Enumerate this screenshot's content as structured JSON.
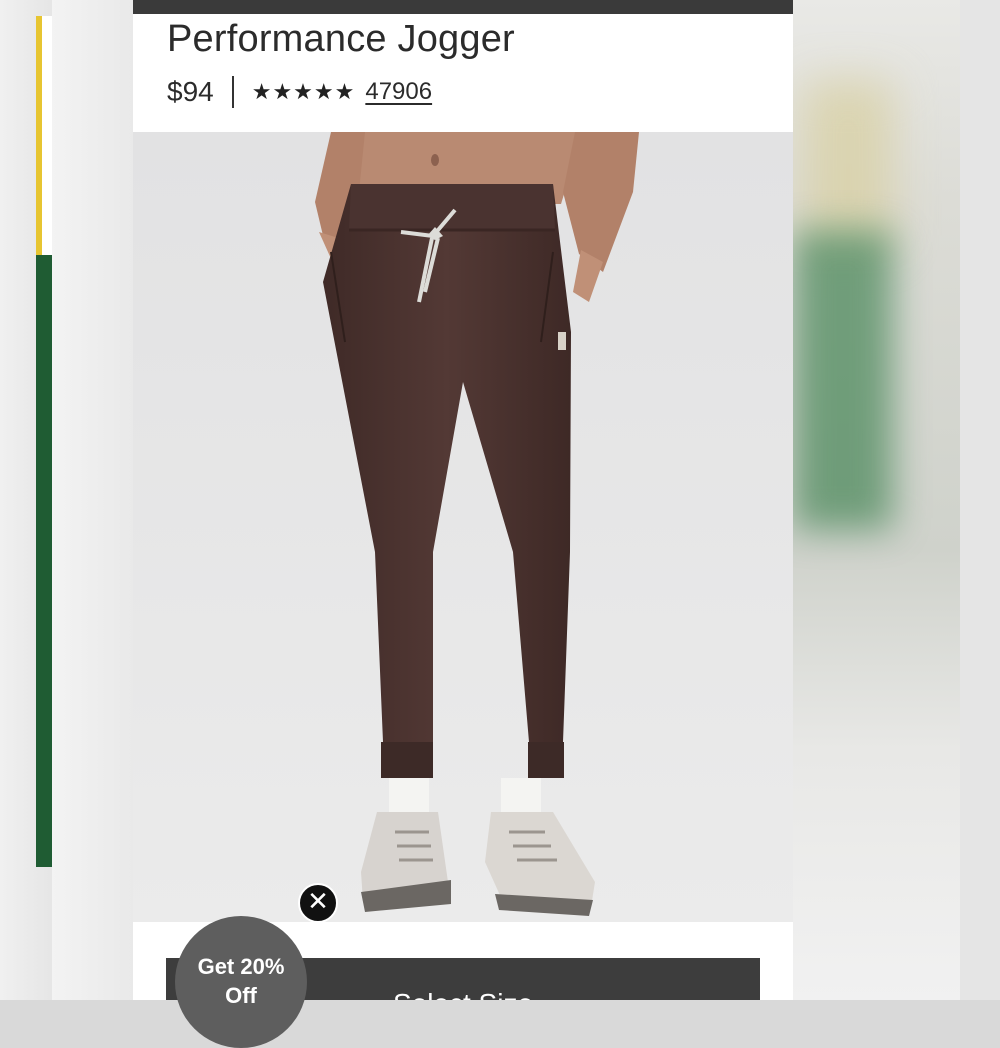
{
  "product": {
    "title": "Performance Jogger",
    "price": "$94",
    "rating_stars": "★★★★★",
    "rating_value": 5,
    "review_count": "47906"
  },
  "promo": {
    "label_line1": "Get 20%",
    "label_line2": "Off"
  },
  "cta": {
    "select_size_label": "Select Size"
  },
  "icons": {
    "close": "close-icon"
  },
  "colors": {
    "jogger": "#4a3330",
    "button": "#3d3d3d",
    "promo_badge": "#5e5e5e",
    "background_green": "#1f5c33"
  }
}
